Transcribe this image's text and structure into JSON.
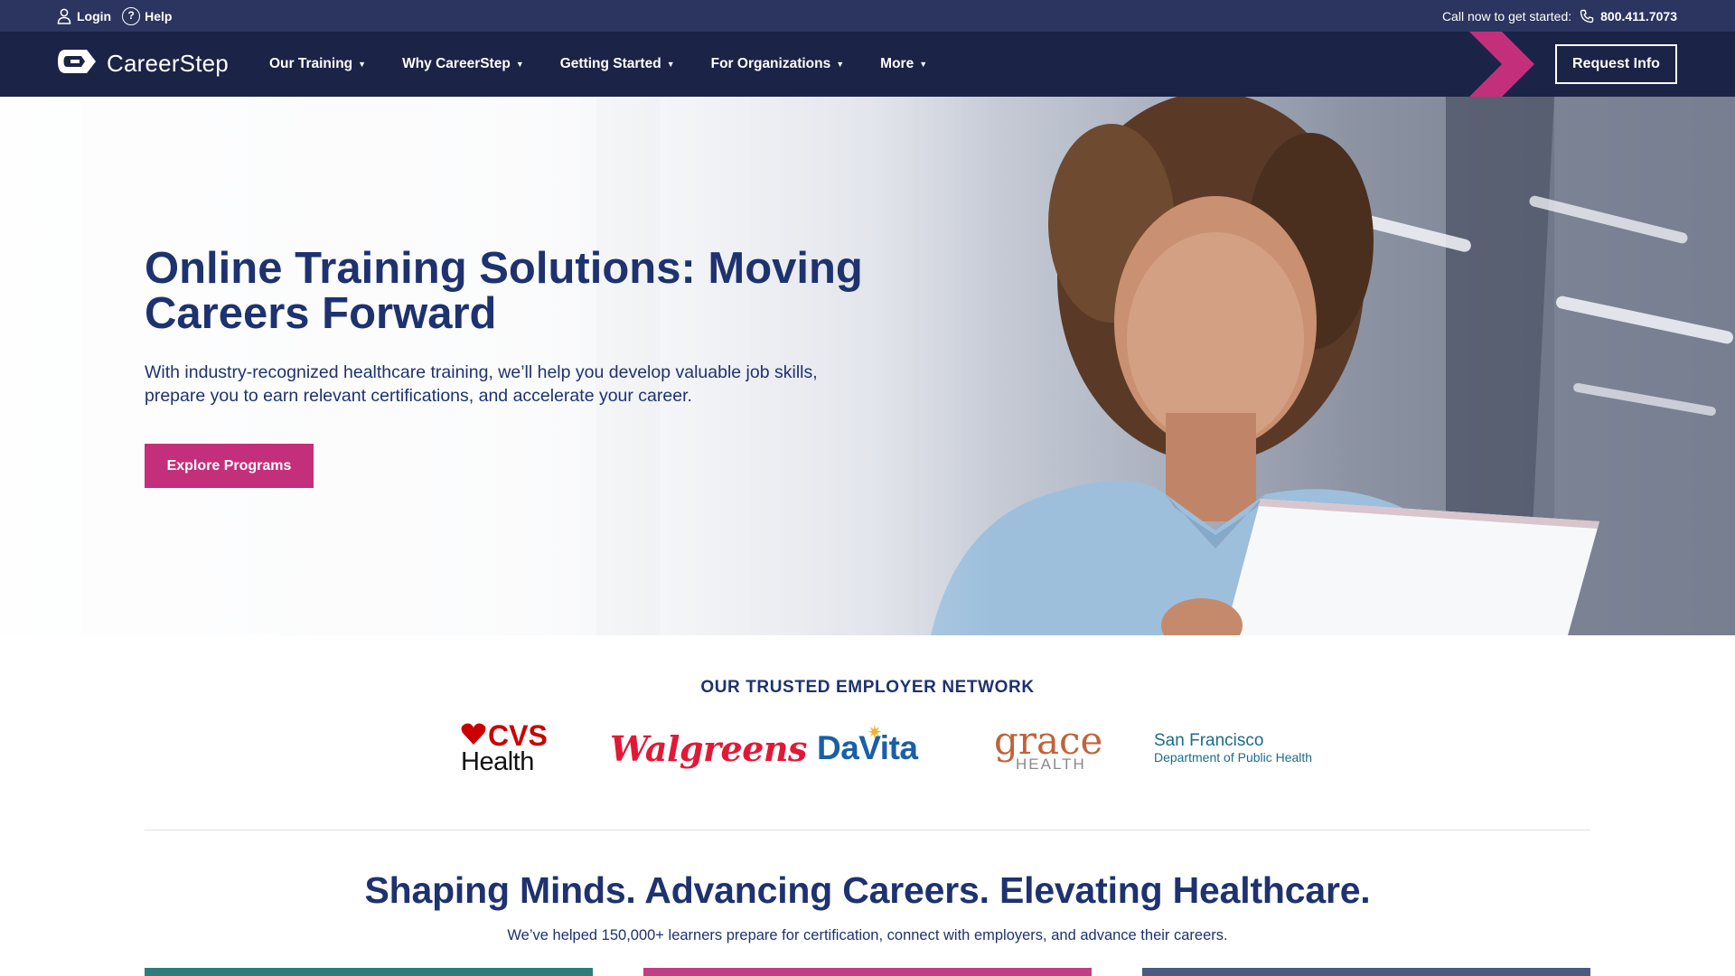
{
  "utility": {
    "login_label": "Login",
    "help_label": "Help",
    "call_text": "Call now to get started:",
    "phone": "800.411.7073"
  },
  "nav": {
    "logo_text": "CareerStep",
    "items": [
      {
        "label": "Our Training"
      },
      {
        "label": "Why CareerStep"
      },
      {
        "label": "Getting Started"
      },
      {
        "label": "For Organizations"
      },
      {
        "label": "More"
      }
    ],
    "cta_label": "Request Info"
  },
  "hero": {
    "title": "Online Training Solutions: Moving Careers Forward",
    "subtitle": "With industry-recognized healthcare training, we’ll help you develop valuable job skills, prepare you to earn relevant certifications, and accelerate your career.",
    "button_label": "Explore Programs"
  },
  "network": {
    "heading": "OUR TRUSTED EMPLOYER NETWORK",
    "logos": {
      "cvs_top": "CVS",
      "cvs_bottom": "Health",
      "walgreens": "Walgreens",
      "davita": "DaVita",
      "grace_top": "grace",
      "grace_bottom": "HEALTH",
      "sf_top": "San Francisco",
      "sf_bottom": "Department of Public Health"
    }
  },
  "mission": {
    "title": "Shaping Minds. Advancing Careers. Elevating Healthcare.",
    "subtitle": "We’ve helped 150,000+ learners prepare for certification, connect with employers, and advance their careers."
  },
  "colors": {
    "utility_bar": "#2c3560",
    "nav_bar": "#1b2346",
    "accent_magenta": "#c42f7c",
    "heading_navy": "#1e3270"
  },
  "icons": {
    "login": "user-icon",
    "help": "question-circle-icon",
    "phone": "phone-icon",
    "logo": "careerstep-logo-icon",
    "accent": "chevron-right-accent"
  }
}
